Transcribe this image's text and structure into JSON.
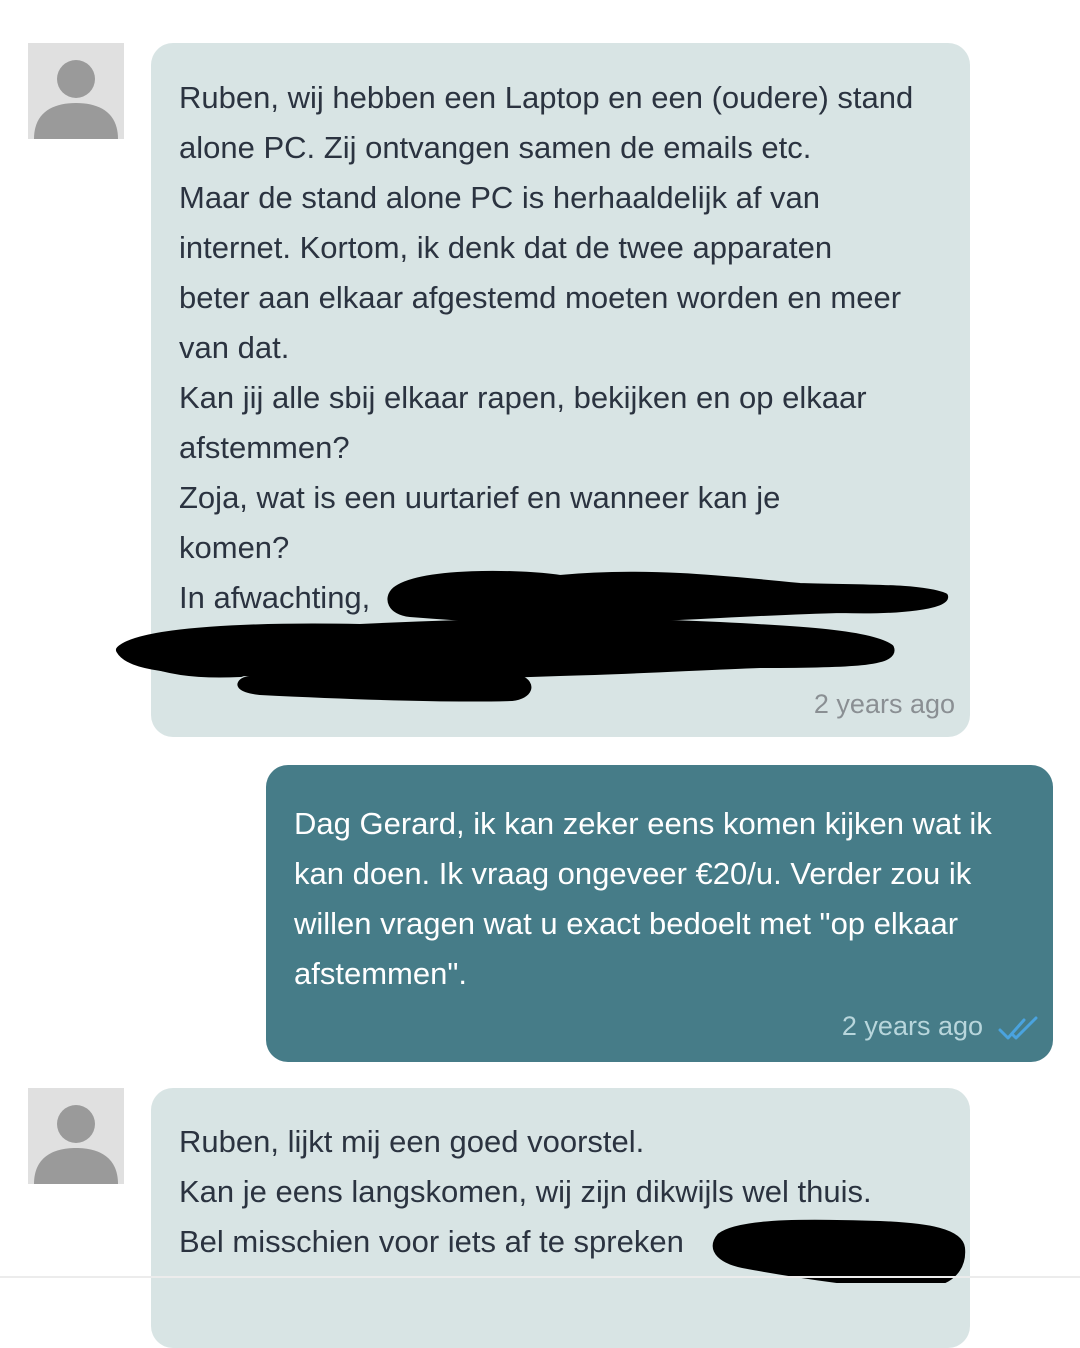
{
  "conversation": {
    "messages": [
      {
        "direction": "incoming",
        "text": "Ruben, wij hebben een Laptop en een (oudere) stand\nalone PC. Zij ontvangen samen de emails etc.\nMaar de stand alone PC is herhaaldelijk af van\ninternet. Kortom, ik denk dat de twee apparaten\nbeter aan elkaar afgestemd moeten worden en meer\nvan dat.\nKan jij alle sbij elkaar rapen, bekijken en op elkaar\nafstemmen?\nZoja, wat is een uurtarief en wanneer kan je\nkomen?\nIn afwachting,",
        "time": "2 years ago"
      },
      {
        "direction": "outgoing",
        "text": "Dag Gerard, ik kan zeker eens komen kijken wat ik\nkan doen. Ik vraag ongeveer €20/u. Verder zou ik\nwillen vragen wat u exact bedoelt met \"op elkaar\nafstemmen\".",
        "time": "2 years ago",
        "status": "read"
      },
      {
        "direction": "incoming",
        "text": "Ruben, lijkt mij een goed voorstel.\nKan je eens langskomen, wij zijn dikwijls wel thuis.\nBel misschien voor iets af te spreken",
        "time": ""
      }
    ]
  },
  "icons": {
    "avatar": "default-user-avatar-icon",
    "read_receipt": "double-check-icon"
  },
  "colors": {
    "incoming_bubble": "#d8e4e4",
    "outgoing_bubble": "#467c88",
    "read_ticks": "#4aa3df"
  }
}
